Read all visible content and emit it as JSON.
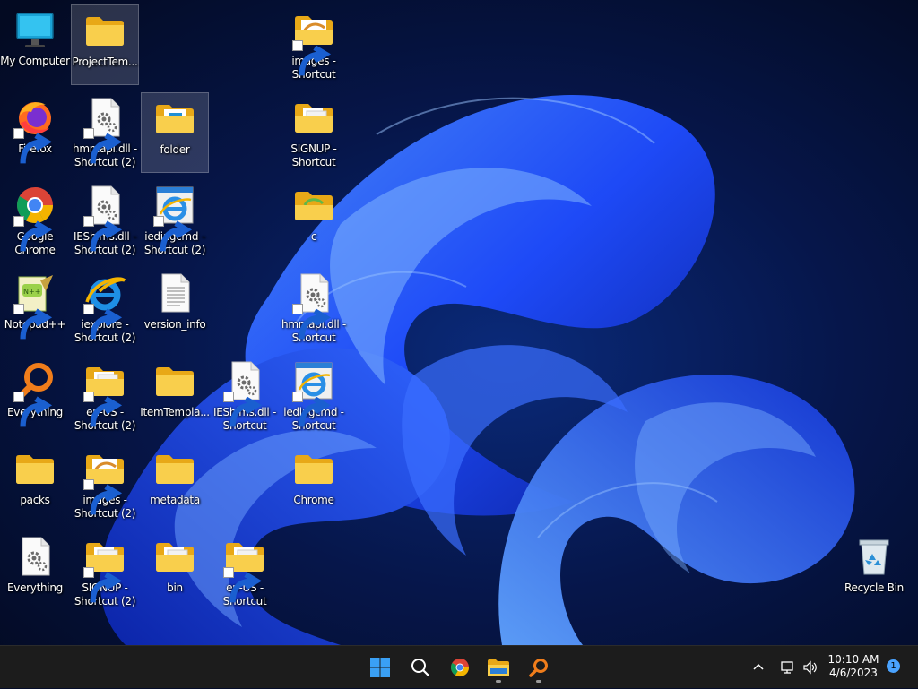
{
  "desktop": {
    "icons": [
      {
        "id": "my-computer",
        "label": "My Computer",
        "type": "monitor",
        "shortcut": false
      },
      {
        "id": "project-templates",
        "label": "ProjectTem...",
        "type": "folder",
        "shortcut": false,
        "selected": true
      },
      {
        "id": "images-shortcut",
        "label": "images -\nShortcut",
        "type": "folder-image",
        "shortcut": true
      },
      {
        "id": "firefox",
        "label": "Firefox",
        "type": "firefox",
        "shortcut": true
      },
      {
        "id": "hmmapi-shortcut-2",
        "label": "hmmapi.dll -\nShortcut (2)",
        "type": "gear-file",
        "shortcut": true
      },
      {
        "id": "folder",
        "label": "folder",
        "type": "folder-doc",
        "shortcut": false,
        "selected": true
      },
      {
        "id": "signup-shortcut",
        "label": "SIGNUP -\nShortcut",
        "type": "folder-docs",
        "shortcut": false
      },
      {
        "id": "google-chrome",
        "label": "Google\nChrome",
        "type": "chrome",
        "shortcut": true
      },
      {
        "id": "ieshims-shortcut-2",
        "label": "IEShims.dll -\nShortcut (2)",
        "type": "gear-file",
        "shortcut": true
      },
      {
        "id": "iediagcmd-shortcut-2",
        "label": "iediagcmd -\nShortcut (2)",
        "type": "ie-file",
        "shortcut": true
      },
      {
        "id": "c-folder",
        "label": "c",
        "type": "folder-green",
        "shortcut": false
      },
      {
        "id": "notepadpp",
        "label": "Notepad++",
        "type": "notepad",
        "shortcut": true
      },
      {
        "id": "iexplore-shortcut-2",
        "label": "iexplore -\nShortcut (2)",
        "type": "ie",
        "shortcut": true
      },
      {
        "id": "version-info",
        "label": "version_info",
        "type": "text-file",
        "shortcut": false
      },
      {
        "id": "hmmapi-shortcut",
        "label": "hmmapi.dll -\nShortcut",
        "type": "gear-file",
        "shortcut": true
      },
      {
        "id": "everything-1",
        "label": "Everything",
        "type": "everything",
        "shortcut": true
      },
      {
        "id": "en-us-shortcut-2",
        "label": "en-US -\nShortcut (2)",
        "type": "folder-docs",
        "shortcut": true
      },
      {
        "id": "itemtemplates",
        "label": "ItemTempla...",
        "type": "folder",
        "shortcut": false
      },
      {
        "id": "ieshims-shortcut",
        "label": "IEShims.dll -\nShortcut",
        "type": "gear-file",
        "shortcut": true
      },
      {
        "id": "iediagcmd-shortcut",
        "label": "iediagcmd -\nShortcut",
        "type": "ie-file",
        "shortcut": true
      },
      {
        "id": "packs",
        "label": "packs",
        "type": "folder",
        "shortcut": false
      },
      {
        "id": "images-shortcut-2",
        "label": "images -\nShortcut (2)",
        "type": "folder-image",
        "shortcut": true
      },
      {
        "id": "metadata",
        "label": "metadata",
        "type": "folder",
        "shortcut": false
      },
      {
        "id": "chrome-folder",
        "label": "Chrome",
        "type": "folder",
        "shortcut": false
      },
      {
        "id": "everything-2",
        "label": "Everything",
        "type": "gear-file",
        "shortcut": false
      },
      {
        "id": "signup-shortcut-2",
        "label": "SIGNUP -\nShortcut (2)",
        "type": "folder-docs",
        "shortcut": true
      },
      {
        "id": "bin",
        "label": "bin",
        "type": "folder-docs",
        "shortcut": false
      },
      {
        "id": "en-us-shortcut",
        "label": "en-US -\nShortcut",
        "type": "folder-docs",
        "shortcut": true
      },
      {
        "id": "recycle-bin",
        "label": "Recycle Bin",
        "type": "recycle",
        "shortcut": false
      }
    ]
  },
  "taskbar": {
    "buttons": [
      {
        "id": "start",
        "name": "windows-start-icon",
        "running": false
      },
      {
        "id": "search",
        "name": "search-icon",
        "running": false
      },
      {
        "id": "chrome",
        "name": "chrome-icon",
        "running": false
      },
      {
        "id": "explorer",
        "name": "file-explorer-icon",
        "running": true
      },
      {
        "id": "everything",
        "name": "everything-search-icon",
        "running": true
      }
    ],
    "tray": {
      "chevron_icon": "chevron-up-icon",
      "network_icon": "network-icon",
      "volume_icon": "volume-icon",
      "time": "10:10 AM",
      "date": "4/6/2023",
      "notification_count": "1"
    }
  },
  "colors": {
    "accent": "#0078d4",
    "taskbar_bg": "#1c1c1c",
    "folder": "#f6c342",
    "wallpaper_blue": "#1f4cff"
  }
}
